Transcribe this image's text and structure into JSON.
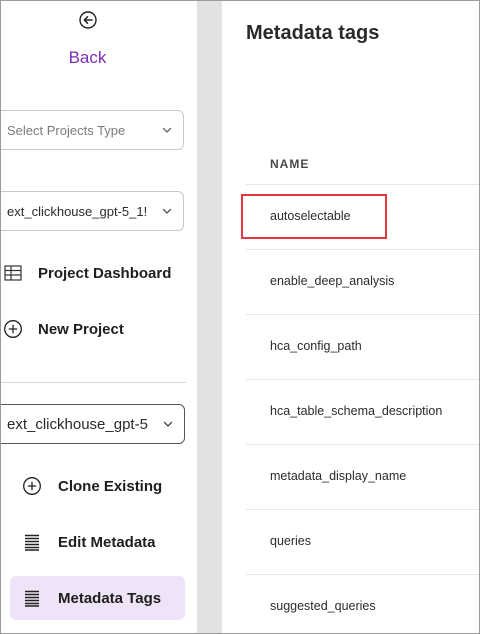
{
  "sidebar": {
    "back_label": "Back",
    "project_type_select": {
      "placeholder": "Select Projects Type"
    },
    "project_select": {
      "value": "ext_clickhouse_gpt-5_1!"
    },
    "nav": {
      "dashboard": {
        "label": "Project Dashboard",
        "icon": "dashboard-grid-icon"
      },
      "new_project": {
        "label": "New Project",
        "icon": "plus-circle-icon"
      }
    },
    "sub_select": {
      "value": "ext_clickhouse_gpt-5"
    },
    "sub_nav": {
      "clone": {
        "label": "Clone Existing",
        "icon": "plus-circle-icon"
      },
      "edit_metadata": {
        "label": "Edit Metadata",
        "icon": "list-lines-icon"
      },
      "metadata_tags": {
        "label": "Metadata Tags",
        "icon": "list-lines-icon",
        "active": true
      }
    }
  },
  "main": {
    "title": "Metadata tags",
    "table": {
      "header": "NAME",
      "rows": [
        "autoselectable",
        "enable_deep_analysis",
        "hca_config_path",
        "hca_table_schema_description",
        "metadata_display_name",
        "queries",
        "suggested_queries"
      ]
    }
  },
  "colors": {
    "accent": "#7b2fb0",
    "active_bg": "#efe3f7",
    "highlight_border": "#e0383e",
    "gutter": "#e2e2e2"
  }
}
